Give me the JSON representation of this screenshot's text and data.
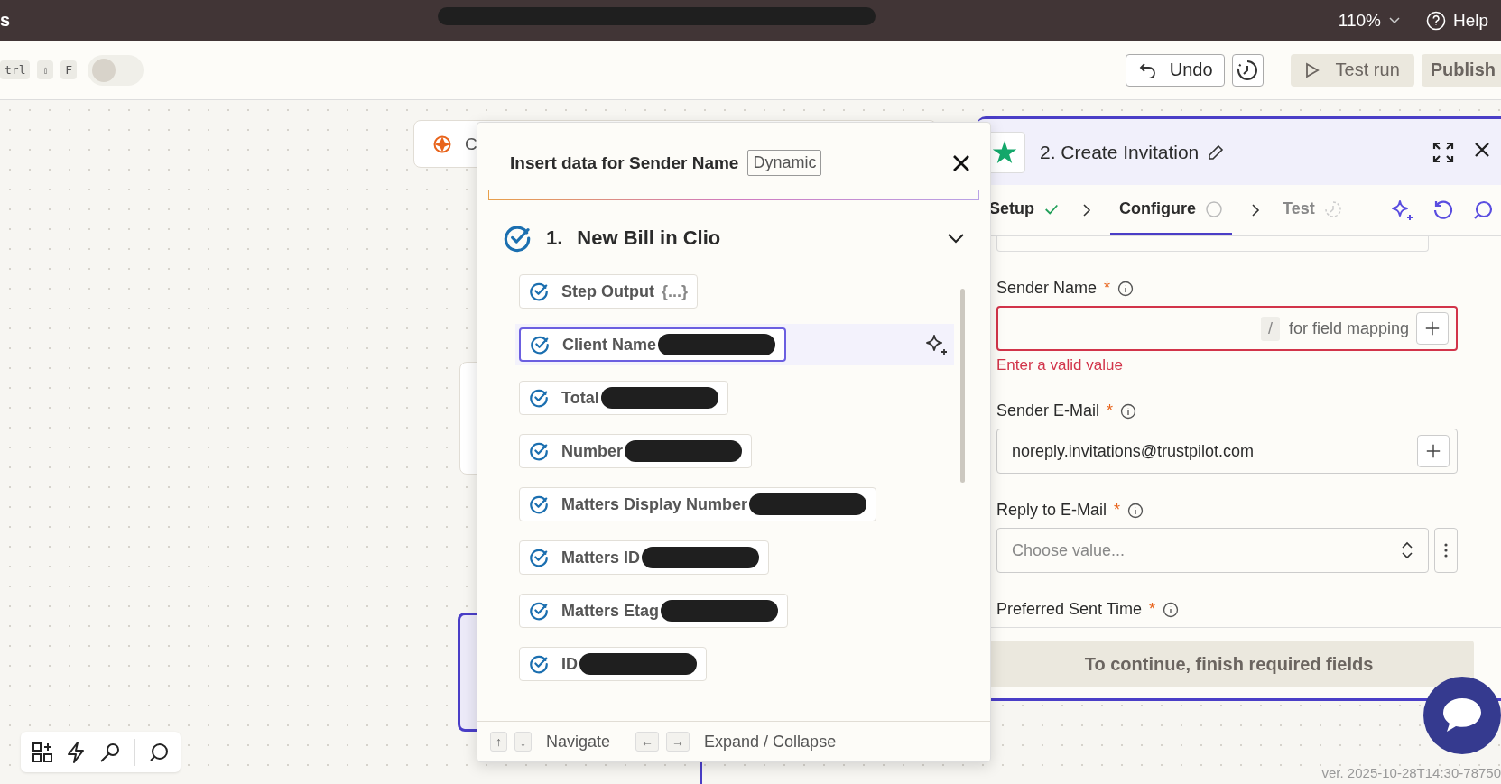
{
  "top_bar": {
    "app_name_fragment": "s",
    "zoom": "110%",
    "help": "Help"
  },
  "toolbar": {
    "shortcut_keys": [
      "trl",
      "⇧",
      "F"
    ],
    "toggle_on": false,
    "undo": "Undo",
    "test_run": "Test run",
    "publish": "Publish"
  },
  "canvas": {
    "node_label_fragment": "C",
    "version": "ver. 2025-10-28T14:30-78750"
  },
  "insert_popup": {
    "title": "Insert data for Sender Name",
    "badge": "Dynamic",
    "step": {
      "number": "1.",
      "title": "New Bill in Clio",
      "expanded": true
    },
    "fields": [
      {
        "label": "Step Output",
        "hint": "{...}",
        "selected": false,
        "redacted": false
      },
      {
        "label": "Client Name",
        "selected": true,
        "redacted": true
      },
      {
        "label": "Total",
        "selected": false,
        "redacted": true
      },
      {
        "label": "Number",
        "selected": false,
        "redacted": true
      },
      {
        "label": "Matters Display Number",
        "selected": false,
        "redacted": true
      },
      {
        "label": "Matters ID",
        "selected": false,
        "redacted": true
      },
      {
        "label": "Matters Etag",
        "selected": false,
        "redacted": true
      },
      {
        "label": "ID",
        "selected": false,
        "redacted": true
      }
    ],
    "footer": {
      "navigate_keys": [
        "↑",
        "↓"
      ],
      "navigate": "Navigate",
      "expand_keys": [
        "←",
        "→"
      ],
      "expand": "Expand / Collapse"
    }
  },
  "step_panel": {
    "title": "2. Create Invitation",
    "required_mark": "*",
    "tabs": [
      {
        "label": "Setup",
        "kind": "done",
        "selected": false
      },
      {
        "label": "Configure",
        "kind": "pending",
        "selected": true
      },
      {
        "label": "Test",
        "kind": "waiting",
        "selected": false
      }
    ],
    "fields": [
      {
        "kind": "mapping",
        "label": "Sender Name",
        "required": true,
        "slash_key": "/",
        "placeholder": "for field mapping",
        "error": "Enter a valid value"
      },
      {
        "kind": "text",
        "label": "Sender E-Mail",
        "required": true,
        "value": "noreply.invitations@trustpilot.com"
      },
      {
        "kind": "select",
        "label": "Reply to E-Mail",
        "required": true,
        "placeholder": "Choose value..."
      },
      {
        "kind": "label_only",
        "label": "Preferred Sent Time",
        "required": true
      }
    ],
    "continue_button": "To continue, finish required fields"
  }
}
